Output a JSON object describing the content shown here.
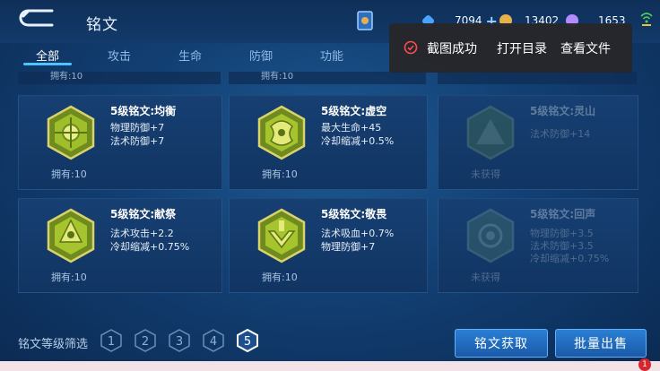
{
  "header": {
    "title": "铭文",
    "resources": [
      {
        "name": "diamond",
        "value": "7094",
        "color": "#4aa3ff"
      },
      {
        "name": "gold",
        "value": "13402",
        "color": "#e7b04a"
      },
      {
        "name": "gem",
        "value": "1653",
        "color": "#b58cff"
      }
    ]
  },
  "tabs": [
    {
      "label": "全部",
      "active": true
    },
    {
      "label": "攻击",
      "active": false
    },
    {
      "label": "生命",
      "active": false
    },
    {
      "label": "防御",
      "active": false
    },
    {
      "label": "功能",
      "active": false
    }
  ],
  "toast": {
    "message": "截图成功",
    "open_folder": "打开目录",
    "view_file": "查看文件"
  },
  "top_row_owned": [
    "拥有:10",
    "拥有:10"
  ],
  "cards": [
    {
      "name": "5级铭文:均衡",
      "attrs": [
        "物理防御+7",
        "法术防御+7"
      ],
      "owned": "拥有:10",
      "locked": false,
      "icon": "balance-rune-icon"
    },
    {
      "name": "5级铭文:虚空",
      "attrs": [
        "最大生命+45",
        "冷却缩减+0.5%"
      ],
      "owned": "拥有:10",
      "locked": false,
      "icon": "void-rune-icon"
    },
    {
      "name": "5级铭文:灵山",
      "attrs": [
        "法术防御+14"
      ],
      "owned": "未获得",
      "locked": true,
      "icon": "spirit-mountain-rune-icon"
    },
    {
      "name": "5级铭文:献祭",
      "attrs": [
        "法术攻击+2.2",
        "冷却缩减+0.75%"
      ],
      "owned": "拥有:10",
      "locked": false,
      "icon": "sacrifice-rune-icon"
    },
    {
      "name": "5级铭文:敬畏",
      "attrs": [
        "法术吸血+0.7%",
        "物理防御+7"
      ],
      "owned": "拥有:10",
      "locked": false,
      "icon": "awe-rune-icon"
    },
    {
      "name": "5级铭文:回声",
      "attrs": [
        "物理防御+3.5",
        "法术防御+3.5",
        "冷却缩减+0.75%"
      ],
      "owned": "未获得",
      "locked": true,
      "icon": "echo-rune-icon"
    }
  ],
  "footer": {
    "filter_label": "铭文等级筛选",
    "levels": [
      "1",
      "2",
      "3",
      "4",
      "5"
    ],
    "selected_level": "5",
    "acquire_button": "铭文获取",
    "bulk_sell_button": "批量出售",
    "notification_count": "1"
  },
  "colors": {
    "accent": "#4fc3ff",
    "button": "#1f6bc0",
    "gold_rune": "#b5c830"
  }
}
